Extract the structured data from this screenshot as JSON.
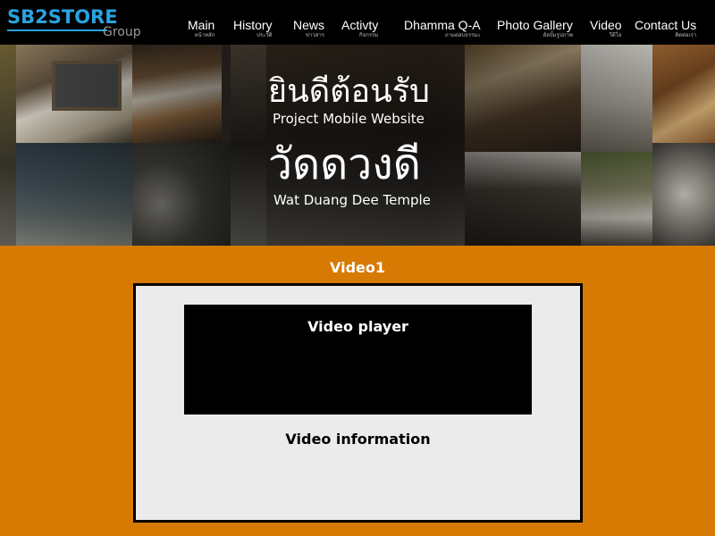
{
  "header": {
    "logo": {
      "main": "SB2STORE",
      "sub": "Group"
    },
    "nav": [
      {
        "label": "Main",
        "sub": "หน้าหลัก"
      },
      {
        "label": "History",
        "sub": "ประวัติ"
      },
      {
        "label": "News",
        "sub": "ข่าวสาร"
      },
      {
        "label": "Activty",
        "sub": "กิจกรรม"
      },
      {
        "label": "Dhamma Q-A",
        "sub": "ถามตอบธรรมะ"
      },
      {
        "label": "Photo Gallery",
        "sub": "อัลบั้มรูปภาพ"
      },
      {
        "label": "Video",
        "sub": "วีดีโอ"
      },
      {
        "label": "Contact Us",
        "sub": "ติดต่อเรา"
      }
    ]
  },
  "banner": {
    "welcome_thai": "ยินดีต้อนรับ",
    "welcome_en": "Project Mobile Website",
    "temple_thai": "วัดดวงดี",
    "temple_en": "Wat Duang Dee Temple"
  },
  "main": {
    "section_title": "Video1",
    "player_label": "Video player",
    "info_label": "Video information"
  },
  "colors": {
    "background": "#d67a03",
    "header": "#000000",
    "logo_blue": "#29a3e0",
    "panel": "#ebebeb"
  }
}
